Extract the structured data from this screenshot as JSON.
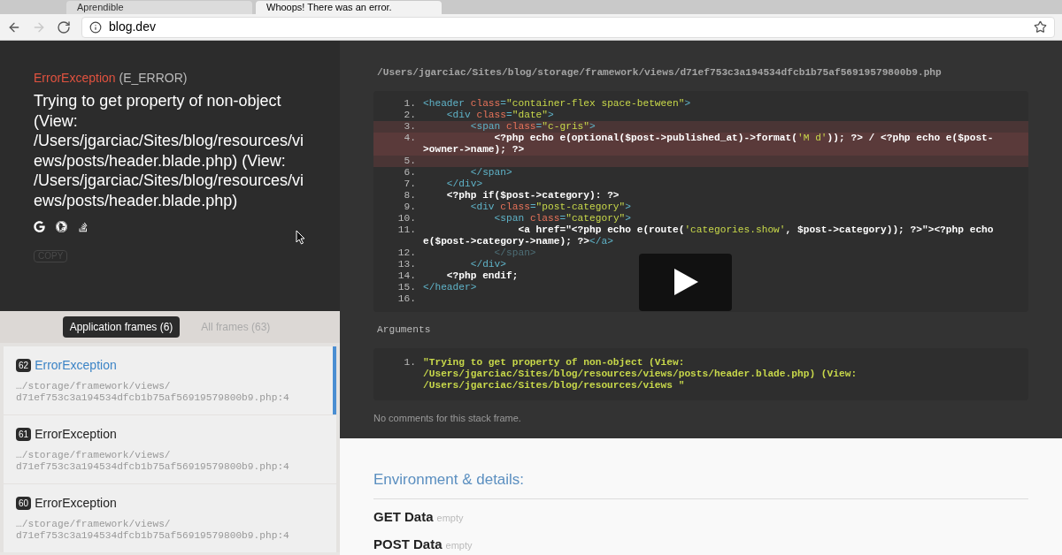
{
  "browser": {
    "tabs": [
      {
        "title": "Aprendible",
        "selected": false
      },
      {
        "title": "Whoops! There was an error.",
        "selected": true
      }
    ],
    "address": "blog.dev",
    "forward_disabled": true
  },
  "exception": {
    "class": "ErrorException",
    "code": "(E_ERROR)",
    "message": "Trying to get property of non-object (View: /Users/jgarciac/Sites/blog/resources/views/posts/header.blade.php) (View: /Users/jgarciac/Sites/blog/resources/views/posts/header.blade.php)",
    "copy_label": "COPY"
  },
  "frame_tabs": [
    {
      "label": "Application frames (6)",
      "selected": true
    },
    {
      "label": "All frames (63)",
      "selected": false
    }
  ],
  "frames": [
    {
      "index": "62",
      "name": "ErrorException",
      "path": "…/storage/framework/views/",
      "file": "d71ef753c3a194534dfcb1b75af56919579800b9.php:4",
      "selected": true
    },
    {
      "index": "61",
      "name": "ErrorException",
      "path": "…/storage/framework/views/",
      "file": "d71ef753c3a194534dfcb1b75af56919579800b9.php:4",
      "selected": false
    },
    {
      "index": "60",
      "name": "ErrorException",
      "path": "…/storage/framework/views/",
      "file": "d71ef753c3a194534dfcb1b75af56919579800b9.php:4",
      "selected": false
    }
  ],
  "code": {
    "file": "/Users/jgarciac/Sites/blog/storage/framework/views/d71ef753c3a194534dfcb1b75af56919579800b9.php",
    "lines": [
      {
        "number": "1.",
        "highlighted": false,
        "selected": false,
        "tokens": [
          {
            "kind": "tag",
            "text": "<header "
          },
          {
            "kind": "attr",
            "text": "class"
          },
          {
            "kind": "tag",
            "text": "="
          },
          {
            "kind": "string",
            "text": "\"container-flex space-between\""
          },
          {
            "kind": "tag",
            "text": ">"
          }
        ]
      },
      {
        "number": "2.",
        "highlighted": false,
        "selected": false,
        "tokens": [
          {
            "kind": "tag",
            "text": "    <div "
          },
          {
            "kind": "attr",
            "text": "class"
          },
          {
            "kind": "tag",
            "text": "="
          },
          {
            "kind": "string",
            "text": "\"date\""
          },
          {
            "kind": "tag",
            "text": ">"
          }
        ]
      },
      {
        "number": "3.",
        "highlighted": true,
        "selected": false,
        "tokens": [
          {
            "kind": "tag",
            "text": "        <span "
          },
          {
            "kind": "attr",
            "text": "class"
          },
          {
            "kind": "tag",
            "text": "="
          },
          {
            "kind": "string",
            "text": "\"c-gris\""
          },
          {
            "kind": "tag",
            "text": ">"
          }
        ]
      },
      {
        "number": "4.",
        "highlighted": true,
        "selected": true,
        "tokens": [
          {
            "kind": "php",
            "text": "            <?php echo e(optional($post->published_at)->format("
          },
          {
            "kind": "string",
            "text": "'M d'"
          },
          {
            "kind": "php",
            "text": ")); ?> / <?php echo e($post->owner->name); ?>"
          }
        ]
      },
      {
        "number": "5.",
        "highlighted": true,
        "selected": false
      },
      {
        "number": "6.",
        "highlighted": false,
        "selected": false,
        "tokens": [
          {
            "kind": "tag",
            "text": "        </span>"
          }
        ]
      },
      {
        "number": "7.",
        "highlighted": false,
        "selected": false,
        "tokens": [
          {
            "kind": "tag",
            "text": "    </div>"
          }
        ]
      },
      {
        "number": "8.",
        "highlighted": false,
        "selected": false,
        "tokens": [
          {
            "kind": "php",
            "text": "    <?php if($post->category): ?>"
          }
        ]
      },
      {
        "number": "9.",
        "highlighted": false,
        "selected": false,
        "tokens": [
          {
            "kind": "tag",
            "text": "        <div "
          },
          {
            "kind": "attr",
            "text": "class"
          },
          {
            "kind": "tag",
            "text": "="
          },
          {
            "kind": "string",
            "text": "\"post-category\""
          },
          {
            "kind": "tag",
            "text": ">"
          }
        ]
      },
      {
        "number": "10.",
        "highlighted": false,
        "selected": false,
        "tokens": [
          {
            "kind": "tag",
            "text": "            <span "
          },
          {
            "kind": "attr",
            "text": "class"
          },
          {
            "kind": "tag",
            "text": "="
          },
          {
            "kind": "string",
            "text": "\"category\""
          },
          {
            "kind": "tag",
            "text": ">"
          }
        ]
      },
      {
        "number": "11.",
        "highlighted": false,
        "selected": false,
        "tokens": [
          {
            "kind": "php",
            "text": "                <a href=\"<?php echo e(route("
          },
          {
            "kind": "string",
            "text": "'categories.show'"
          },
          {
            "kind": "php",
            "text": ", $post->category)); ?>\"><?php echo e($post->category->name); ?>"
          },
          {
            "kind": "tag",
            "text": "</a>"
          }
        ]
      },
      {
        "number": "12.",
        "highlighted": false,
        "selected": false,
        "tokens": [
          {
            "kind": "dim",
            "text": "            </span>"
          }
        ]
      },
      {
        "number": "13.",
        "highlighted": false,
        "selected": false,
        "tokens": [
          {
            "kind": "tag",
            "text": "        </div>"
          }
        ]
      },
      {
        "number": "14.",
        "highlighted": false,
        "selected": false,
        "tokens": [
          {
            "kind": "php",
            "text": "    <?php endif;"
          }
        ]
      },
      {
        "number": "15.",
        "highlighted": false,
        "selected": false,
        "tokens": [
          {
            "kind": "tag",
            "text": "</header>"
          }
        ]
      },
      {
        "number": "16.",
        "highlighted": false,
        "selected": false
      }
    ]
  },
  "arguments_label": "Arguments",
  "arguments": [
    {
      "number": "1.",
      "value": "\"Trying to get property of non-object (View: /Users/jgarciac/Sites/blog/resources/views/posts/header.blade.php) (View: /Users/jgarciac/Sites/blog/resources/views \""
    }
  ],
  "comments": "No comments for this stack frame.",
  "environment": {
    "title": "Environment & details:",
    "sections": [
      {
        "name": "GET Data",
        "value": "empty"
      },
      {
        "name": "POST Data",
        "value": "empty"
      }
    ]
  }
}
